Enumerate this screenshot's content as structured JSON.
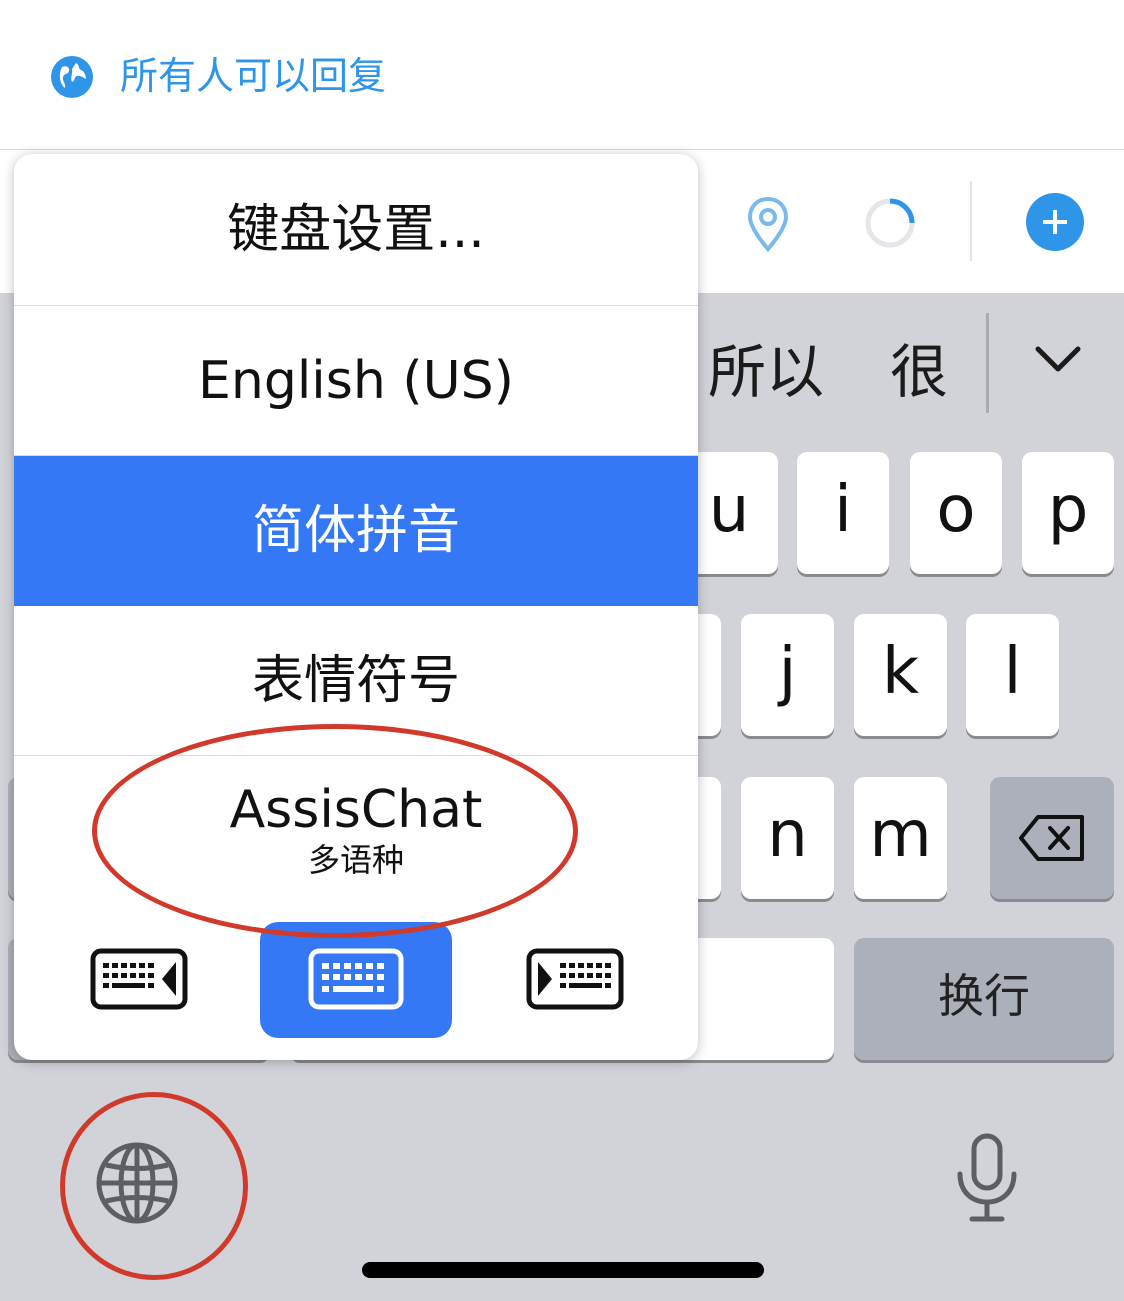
{
  "reply_bar": {
    "icon": "globe-icon",
    "text": "所有人可以回复",
    "color": "#2f95e8"
  },
  "toolbar": {
    "icons": [
      "location-pin-icon",
      "progress-ring-icon",
      "add-circle-icon"
    ]
  },
  "candidates": {
    "words": [
      "所以",
      "很"
    ],
    "expand_icon": "chevron-down-icon"
  },
  "keys": {
    "row1": [
      "u",
      "i",
      "o",
      "p"
    ],
    "row2": [
      "j",
      "k",
      "l"
    ],
    "row3": [
      "n",
      "m"
    ],
    "delete_icon": "backspace-icon",
    "return_label": "换行",
    "globe_icon": "globe-icon",
    "mic_icon": "microphone-icon"
  },
  "popup": {
    "items": [
      {
        "label": "键盘设置..."
      },
      {
        "label": "English (US)"
      },
      {
        "label": "简体拼音",
        "selected": true
      },
      {
        "label": "表情符号"
      },
      {
        "label": "AssisChat",
        "sublabel": "多语种"
      }
    ],
    "layout_options": [
      "keyboard-left-icon",
      "keyboard-full-icon",
      "keyboard-right-icon"
    ],
    "active_layout": "keyboard-full-icon"
  },
  "colors": {
    "accent": "#3478f6",
    "annotation": "#d13a2b",
    "keyboard_bg": "#d1d3d9"
  }
}
